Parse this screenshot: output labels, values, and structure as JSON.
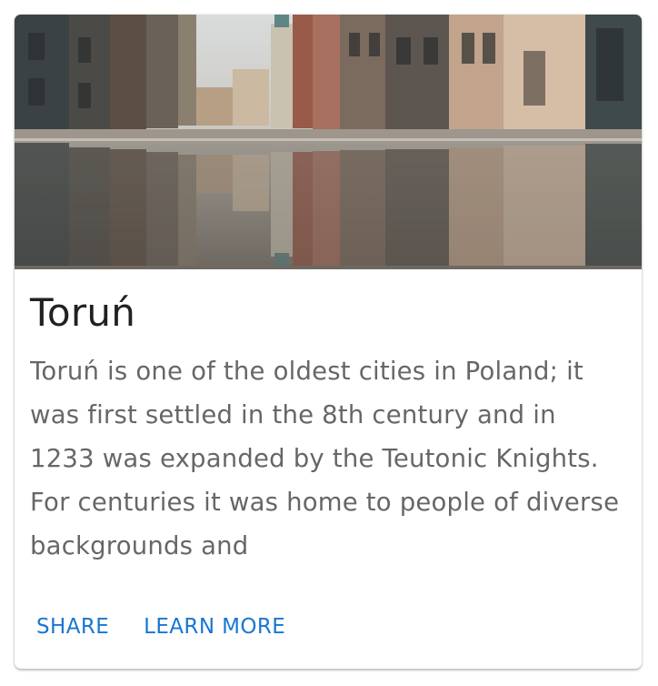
{
  "card": {
    "image": {
      "alt": "Old town street reflected in a puddle"
    },
    "title": "Toruń",
    "description": "Toruń is one of the oldest cities in Poland; it was first settled in the 8th century and in 1233 was expanded by the Teutonic Knights. For centuries it was home to people of diverse backgrounds and",
    "actions": {
      "share_label": "SHARE",
      "learn_more_label": "LEARN MORE"
    }
  },
  "colors": {
    "primary": "#1976d2",
    "title_text": "#212121",
    "body_text": "#666666"
  }
}
